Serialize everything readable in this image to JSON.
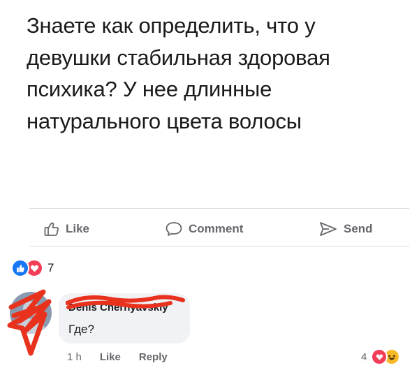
{
  "post": {
    "lines": [
      "Знаете как определить, что у",
      "девушки стабильная здоровая",
      "психика? У нее длинные",
      "натурального цвета волосы"
    ]
  },
  "actions": {
    "like_label": "Like",
    "comment_label": "Comment",
    "send_label": "Send"
  },
  "reactions": {
    "icons": [
      "like-icon",
      "love-icon"
    ],
    "count": "7"
  },
  "comment": {
    "author": "Denis Chernyavskiy",
    "text": "Где?",
    "time": "1 h",
    "like_label": "Like",
    "reply_label": "Reply",
    "reaction_count": "4",
    "reaction_icons": [
      "love-icon",
      "haha-icon"
    ]
  },
  "colors": {
    "brand_blue": "#1877f2",
    "love_red": "#f33e58",
    "haha_yellow": "#f7b928",
    "redaction_red": "#e8321e",
    "muted_text": "#65676b",
    "bubble_bg": "#f0f2f5"
  }
}
